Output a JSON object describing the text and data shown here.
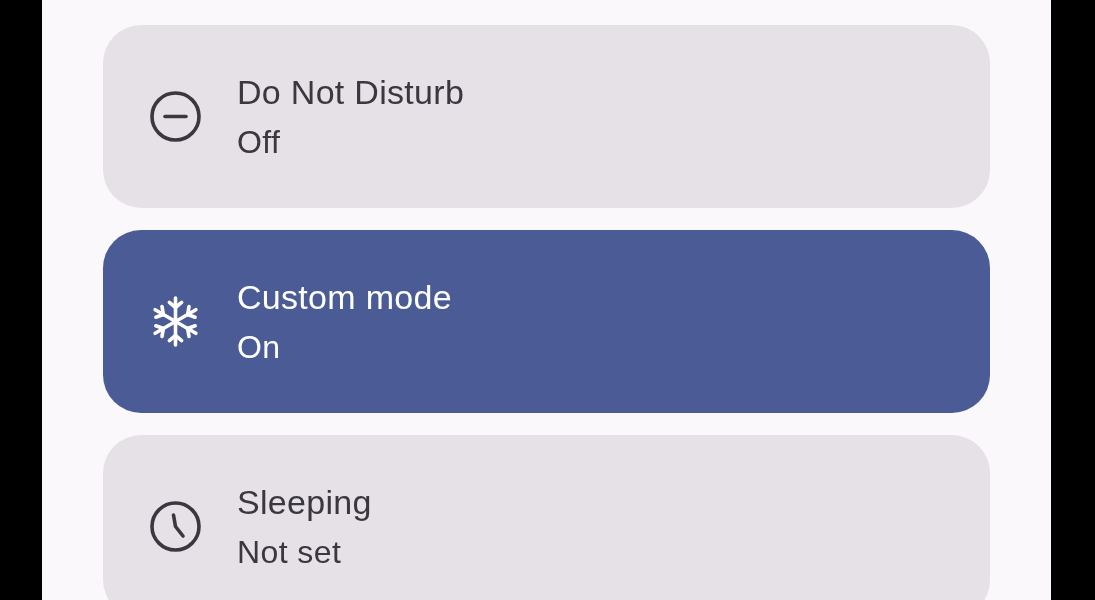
{
  "modes": [
    {
      "kind": "dnd",
      "title": "Do Not Disturb",
      "status": "Off",
      "on": false
    },
    {
      "kind": "custom",
      "title": "Custom mode",
      "status": "On",
      "on": true
    },
    {
      "kind": "sleep",
      "title": "Sleeping",
      "status": "Not set",
      "on": false
    }
  ]
}
